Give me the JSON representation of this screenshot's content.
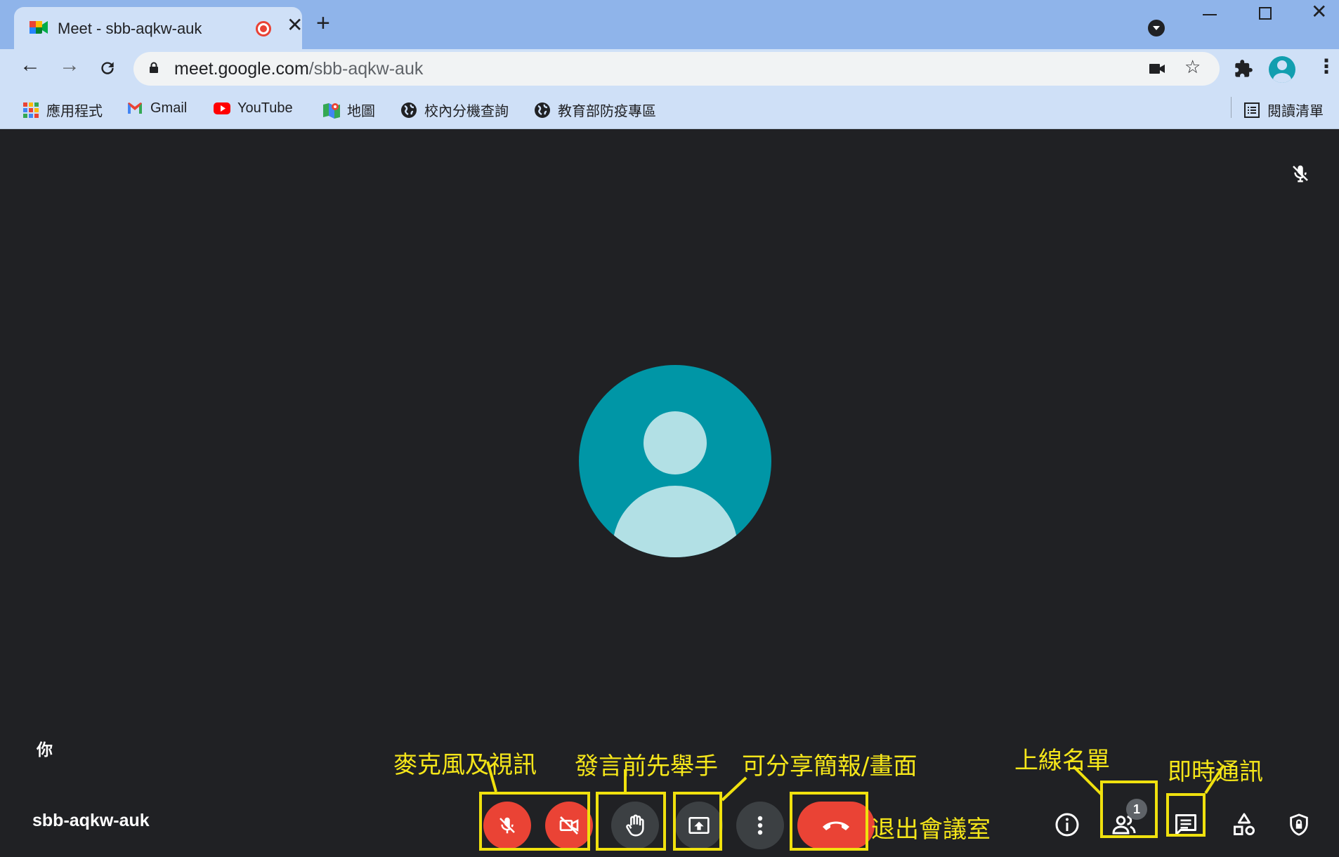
{
  "browser": {
    "tab_title": "Meet - sbb-aqkw-auk",
    "new_tab_symbol": "+",
    "close_symbol": "✕",
    "url_host": "meet.google.com",
    "url_path": "/sbb-aqkw-auk",
    "bookmarks": [
      {
        "label": "應用程式",
        "icon": "apps-grid-icon"
      },
      {
        "label": "Gmail",
        "icon": "gmail-icon"
      },
      {
        "label": "YouTube",
        "icon": "youtube-icon"
      },
      {
        "label": "地圖",
        "icon": "maps-icon"
      },
      {
        "label": "校內分機查詢",
        "icon": "globe-icon"
      },
      {
        "label": "教育部防疫專區",
        "icon": "globe-icon"
      }
    ],
    "reading_list": "閱讀清單"
  },
  "meet": {
    "self_label": "你",
    "meeting_code": "sbb-aqkw-auk",
    "participant_count": "1",
    "colors": {
      "background": "#202124",
      "control": "#3c4043",
      "hangup": "#ea4335",
      "avatar": "#0096a6",
      "annotation": "#f0e10e"
    }
  },
  "annotations": {
    "mic_video": "麥克風及視訊",
    "raise_hand": "發言前先舉手",
    "present": "可分享簡報/畫面",
    "leave": "退出會議室",
    "people": "上線名單",
    "chat": "即時通訊"
  }
}
